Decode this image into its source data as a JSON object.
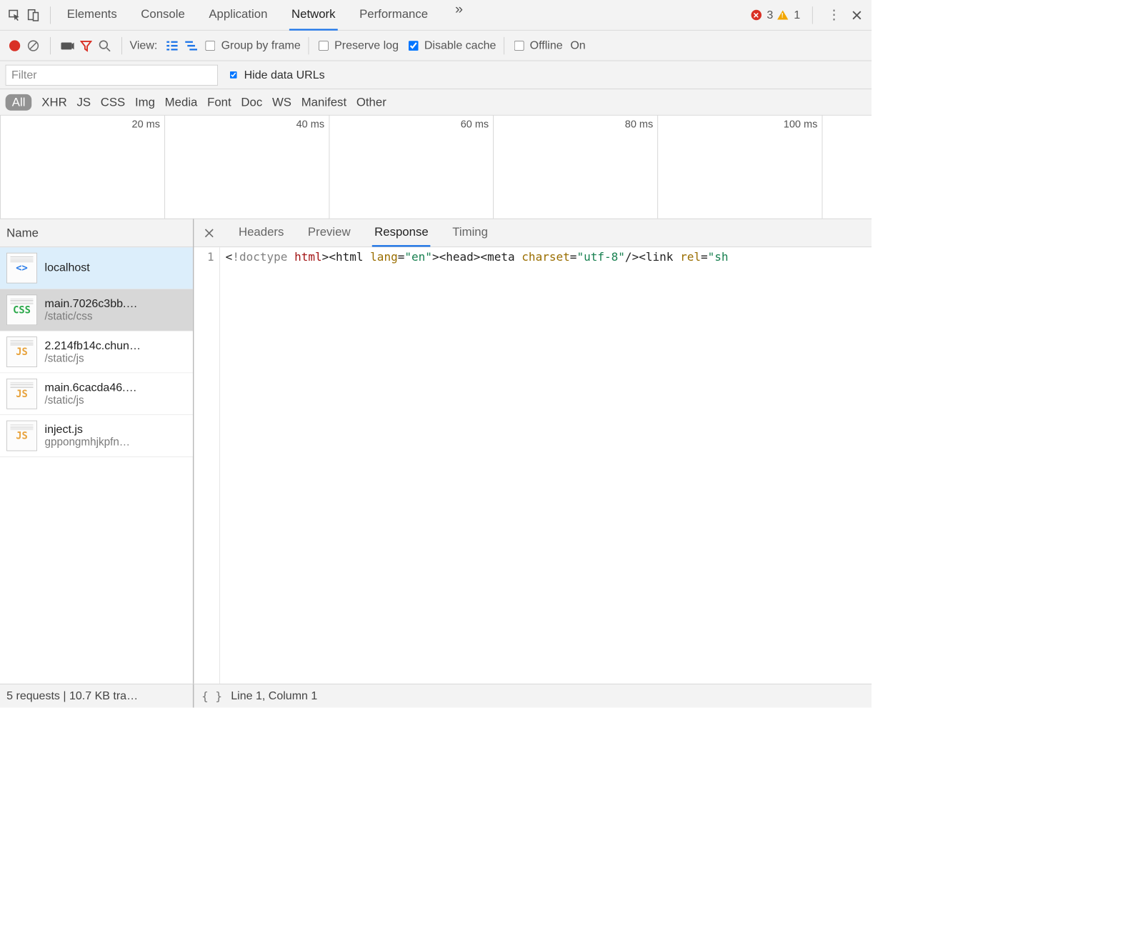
{
  "top": {
    "tabs": [
      "Elements",
      "Console",
      "Application",
      "Network",
      "Performance"
    ],
    "active_tab": "Network",
    "errors": 3,
    "warnings": 1
  },
  "net_toolbar": {
    "view_label": "View:",
    "group_by_frame": "Group by frame",
    "preserve_log": "Preserve log",
    "disable_cache": "Disable cache",
    "offline": "Offline",
    "online_label": "On",
    "group_by_frame_checked": false,
    "preserve_log_checked": false,
    "disable_cache_checked": true,
    "offline_checked": false
  },
  "filter_row": {
    "placeholder": "Filter",
    "value": "",
    "hide_data_urls": "Hide data URLs",
    "hide_data_urls_checked": true
  },
  "type_row": {
    "all": "All",
    "types": [
      "XHR",
      "JS",
      "CSS",
      "Img",
      "Media",
      "Font",
      "Doc",
      "WS",
      "Manifest",
      "Other"
    ]
  },
  "timeline": {
    "ticks": [
      "20 ms",
      "40 ms",
      "60 ms",
      "80 ms",
      "100 ms"
    ]
  },
  "left": {
    "header": "Name",
    "requests": [
      {
        "name": "localhost",
        "path": "",
        "type": "html",
        "icon_text": "<>",
        "selected": true
      },
      {
        "name": "main.7026c3bb.…",
        "path": "/static/css",
        "type": "css",
        "icon_text": "CSS",
        "hover": true
      },
      {
        "name": "2.214fb14c.chun…",
        "path": "/static/js",
        "type": "js",
        "icon_text": "JS"
      },
      {
        "name": "main.6cacda46.…",
        "path": "/static/js",
        "type": "js",
        "icon_text": "JS"
      },
      {
        "name": "inject.js",
        "path": "gppongmhjkpfn…",
        "type": "js",
        "icon_text": "JS"
      }
    ]
  },
  "detail": {
    "tabs": [
      "Headers",
      "Preview",
      "Response",
      "Timing"
    ],
    "active": "Response",
    "line_number": "1",
    "code_tokens": [
      {
        "t": "<",
        "c": "tag"
      },
      {
        "t": "!doctype",
        "c": "dt"
      },
      {
        "t": " ",
        "c": "tag"
      },
      {
        "t": "html",
        "c": "kw"
      },
      {
        "t": "><",
        "c": "tag"
      },
      {
        "t": "html ",
        "c": "tag"
      },
      {
        "t": "lang",
        "c": "attr"
      },
      {
        "t": "=",
        "c": "tag"
      },
      {
        "t": "\"en\"",
        "c": "str"
      },
      {
        "t": "><",
        "c": "tag"
      },
      {
        "t": "head",
        "c": "tag"
      },
      {
        "t": "><",
        "c": "tag"
      },
      {
        "t": "meta ",
        "c": "tag"
      },
      {
        "t": "charset",
        "c": "attr"
      },
      {
        "t": "=",
        "c": "tag"
      },
      {
        "t": "\"utf-8\"",
        "c": "str"
      },
      {
        "t": "/><",
        "c": "tag"
      },
      {
        "t": "link ",
        "c": "tag"
      },
      {
        "t": "rel",
        "c": "attr"
      },
      {
        "t": "=",
        "c": "tag"
      },
      {
        "t": "\"sh",
        "c": "str"
      }
    ]
  },
  "status": {
    "summary": "5 requests | 10.7 KB tra…",
    "braces": "{ }",
    "cursor": "Line 1, Column 1"
  }
}
